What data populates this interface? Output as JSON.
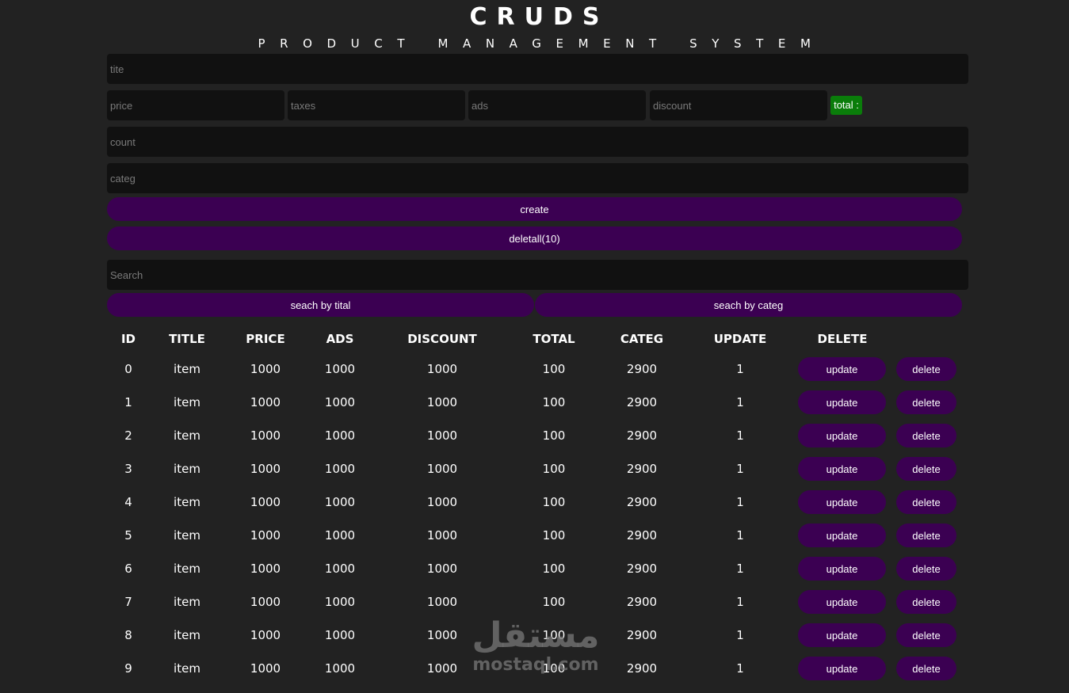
{
  "header": {
    "title": "CRUDS",
    "subtitle": "PRODUCT MANAGEMENT SYSTEM"
  },
  "form": {
    "title_placeholder": "tite",
    "price_placeholder": "price",
    "taxes_placeholder": "taxes",
    "ads_placeholder": "ads",
    "discount_placeholder": "discount",
    "total_label": "total :",
    "count_placeholder": "count",
    "category_placeholder": "categ",
    "create_label": "create",
    "delete_all_label": "deletall(10)"
  },
  "search": {
    "placeholder": "Search",
    "by_title_label": "seach by tital",
    "by_category_label": "seach by categ"
  },
  "table": {
    "headers": [
      "ID",
      "TITLE",
      "PRICE",
      "ADS",
      "DISCOUNT",
      "TOTAL",
      "CATEG",
      "UPDATE",
      "DELETE"
    ],
    "update_label": "update",
    "delete_label": "delete",
    "rows": [
      [
        "0",
        "item",
        "1000",
        "1000",
        "1000",
        "100",
        "2900",
        "1"
      ],
      [
        "1",
        "item",
        "1000",
        "1000",
        "1000",
        "100",
        "2900",
        "1"
      ],
      [
        "2",
        "item",
        "1000",
        "1000",
        "1000",
        "100",
        "2900",
        "1"
      ],
      [
        "3",
        "item",
        "1000",
        "1000",
        "1000",
        "100",
        "2900",
        "1"
      ],
      [
        "4",
        "item",
        "1000",
        "1000",
        "1000",
        "100",
        "2900",
        "1"
      ],
      [
        "5",
        "item",
        "1000",
        "1000",
        "1000",
        "100",
        "2900",
        "1"
      ],
      [
        "6",
        "item",
        "1000",
        "1000",
        "1000",
        "100",
        "2900",
        "1"
      ],
      [
        "7",
        "item",
        "1000",
        "1000",
        "1000",
        "100",
        "2900",
        "1"
      ],
      [
        "8",
        "item",
        "1000",
        "1000",
        "1000",
        "100",
        "2900",
        "1"
      ],
      [
        "9",
        "item",
        "1000",
        "1000",
        "1000",
        "100",
        "2900",
        "1"
      ]
    ]
  },
  "watermark": {
    "arabic": "مستقل",
    "latin": "mostaql.com"
  },
  "colors": {
    "background": "#222222",
    "input": "#111111",
    "button": "#3b0052",
    "total_badge": "#0a7d0a"
  }
}
